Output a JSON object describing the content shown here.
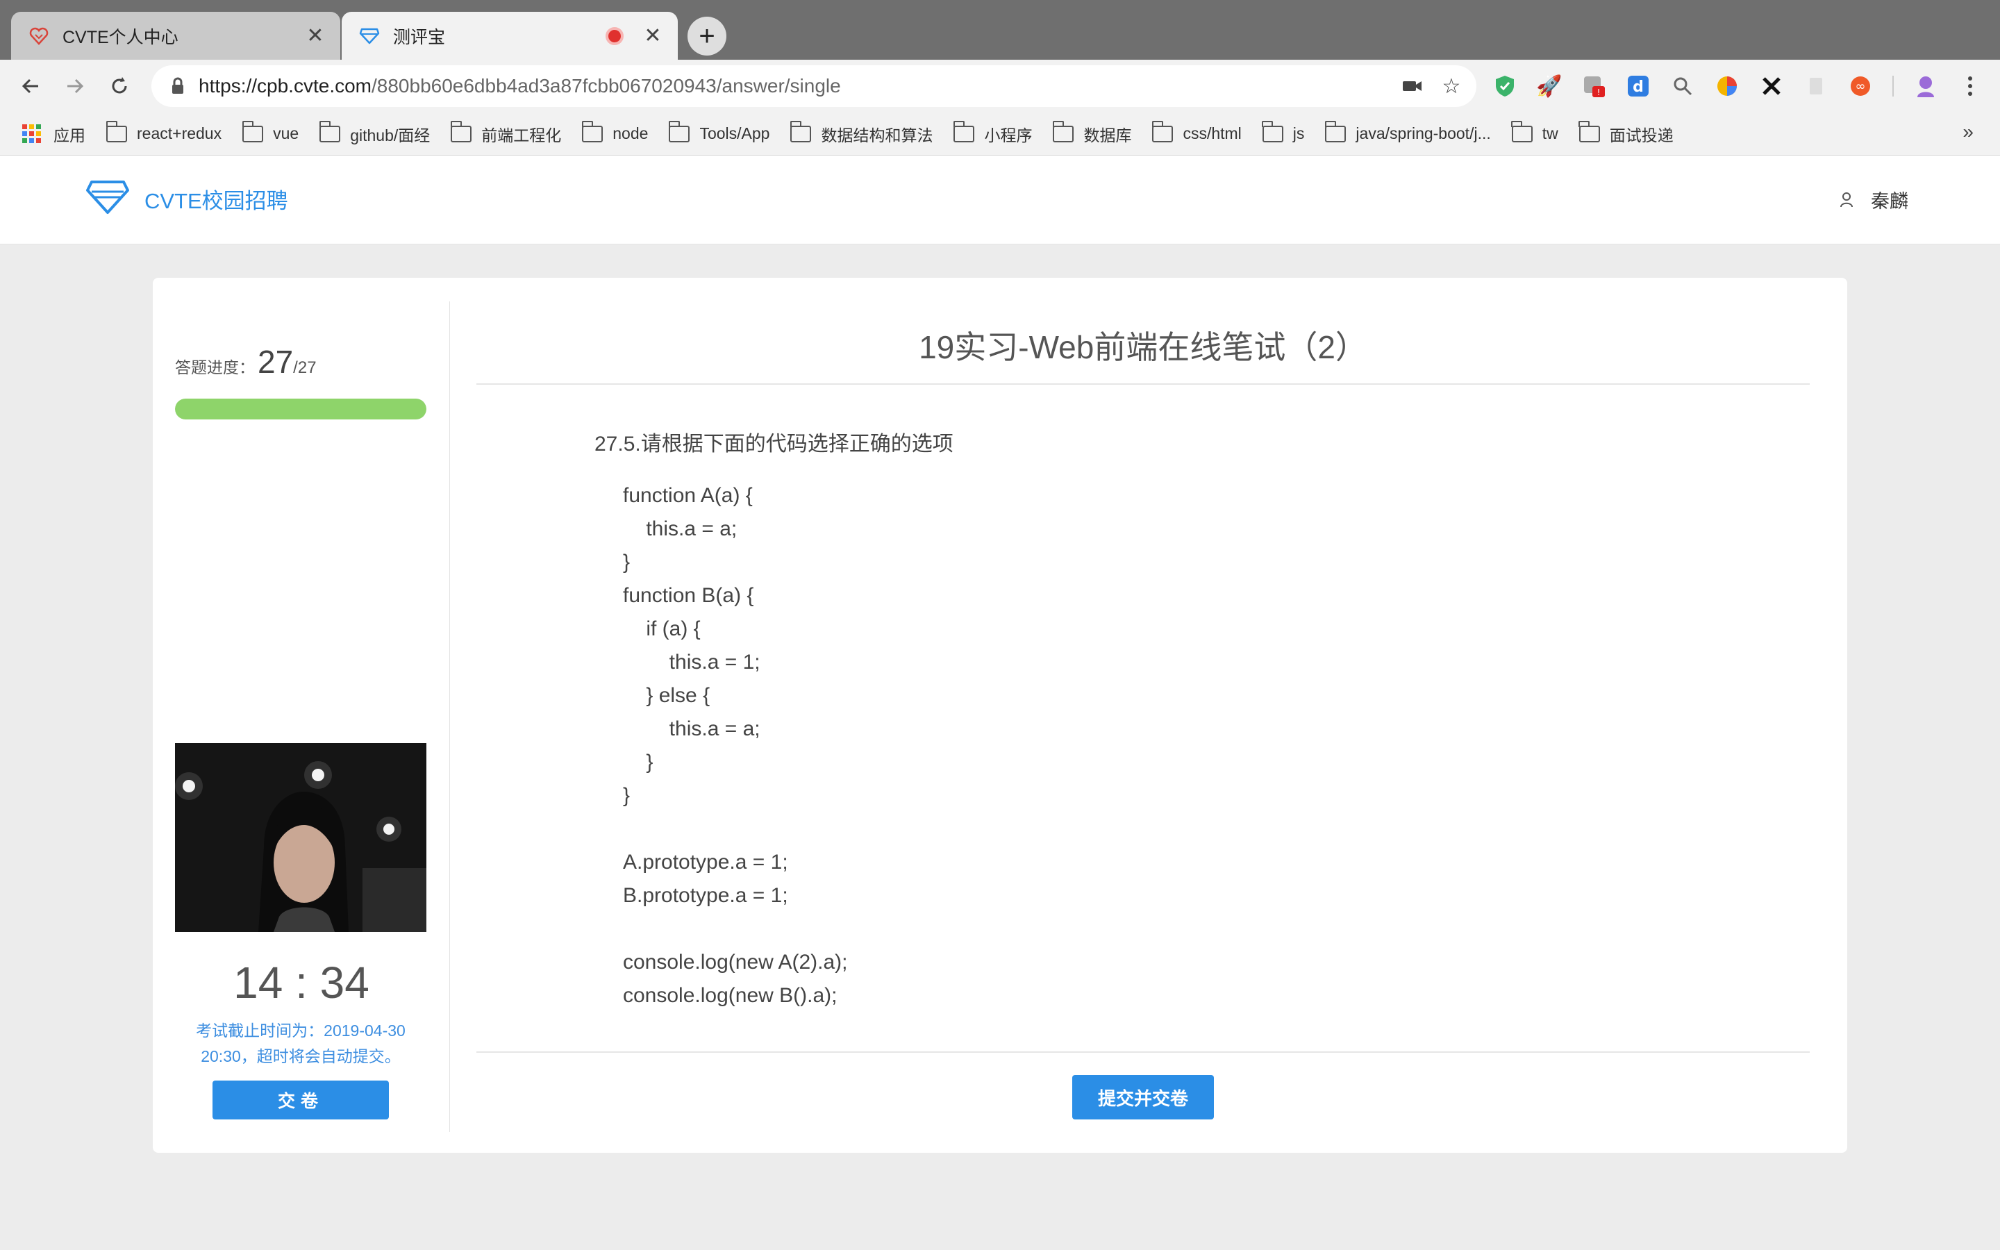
{
  "browser": {
    "tabs": [
      {
        "title": "CVTE个人中心",
        "icon": "cvte-heart-icon"
      },
      {
        "title": "测评宝",
        "icon": "diamond-icon",
        "recording": true
      }
    ],
    "url_host": "https://cpb.cvte.com",
    "url_path": "/880bb60e6dbb4ad3a87fcbb067020943/answer/single",
    "bookmarks": [
      "应用",
      "react+redux",
      "vue",
      "github/面经",
      "前端工程化",
      "node",
      "Tools/App",
      "数据结构和算法",
      "小程序",
      "数据库",
      "css/html",
      "js",
      "java/spring-boot/j...",
      "tw",
      "面试投递"
    ],
    "more_bookmarks": "»"
  },
  "site": {
    "brand": "CVTE校园招聘",
    "user_name": "秦麟",
    "brand_color": "#2b8ee6"
  },
  "progress": {
    "label": "答题进度：",
    "current": "27",
    "total": "/27",
    "fraction": 1.0,
    "bar_color": "#8ed46a"
  },
  "timer": "14 : 34",
  "deadline_text": "考试截止时间为：2019-04-30 20:30，超时将会自动提交。",
  "submit_small_label": "交卷",
  "exam_title": "19实习-Web前端在线笔试（2）",
  "question_title": "27.5.请根据下面的代码选择正确的选项",
  "code_lines": [
    "function A(a) {",
    "    this.a = a;",
    "}",
    "function B(a) {",
    "    if (a) {",
    "        this.a = 1;",
    "    } else {",
    "        this.a = a;",
    "    }",
    "}",
    "",
    "A.prototype.a = 1;",
    "B.prototype.a = 1;",
    "",
    "console.log(new A(2).a);",
    "console.log(new B().a);"
  ],
  "submit_big_label": "提交并交卷"
}
